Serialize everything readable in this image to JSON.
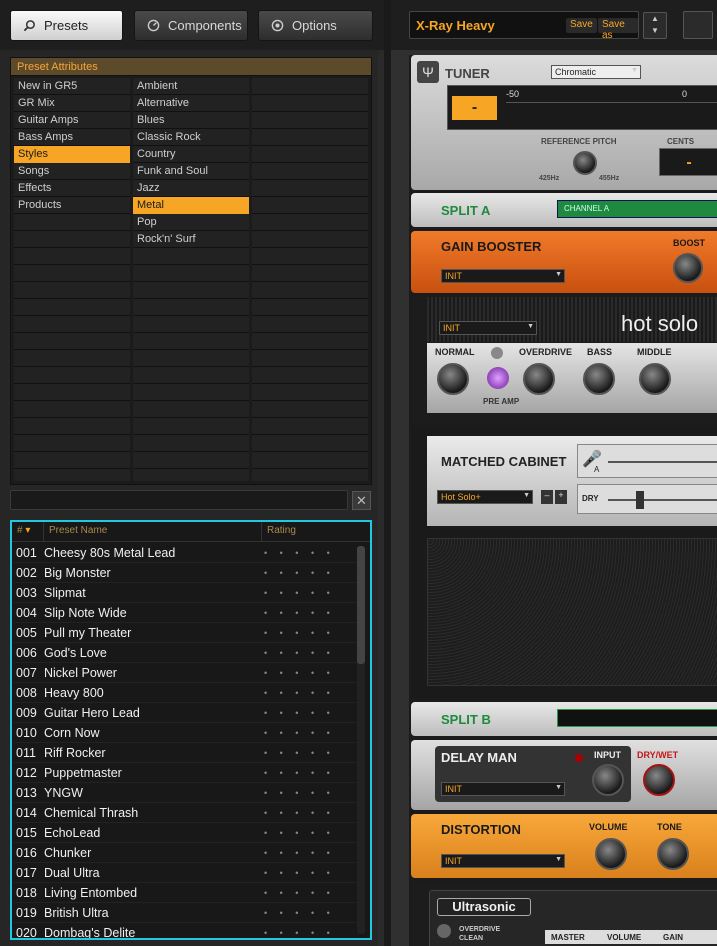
{
  "tabs": [
    {
      "label": "Presets",
      "active": true,
      "icon": "magnifier-icon"
    },
    {
      "label": "Components",
      "active": false,
      "icon": "gauge-icon"
    },
    {
      "label": "Options",
      "active": false,
      "icon": "gear-icon"
    }
  ],
  "attributes": {
    "header": "Preset Attributes",
    "categories": [
      "New in GR5",
      "GR Mix",
      "Guitar Amps",
      "Bass Amps",
      "Styles",
      "Songs",
      "Effects",
      "Products"
    ],
    "selected_category": "Styles",
    "styles": [
      "Ambient",
      "Alternative",
      "Blues",
      "Classic Rock",
      "Country",
      "Funk and Soul",
      "Jazz",
      "Metal",
      "Pop",
      "Rock'n' Surf"
    ],
    "selected_style": "Metal"
  },
  "search": {
    "value": "",
    "clear_icon": "close-icon"
  },
  "results": {
    "headers": {
      "number": "#",
      "name": "Preset Name",
      "rating": "Rating"
    },
    "rows": [
      {
        "no": "001",
        "name": "Cheesy 80s Metal Lead"
      },
      {
        "no": "002",
        "name": "Big Monster"
      },
      {
        "no": "003",
        "name": "Slipmat"
      },
      {
        "no": "004",
        "name": "Slip Note Wide"
      },
      {
        "no": "005",
        "name": "Pull my Theater"
      },
      {
        "no": "006",
        "name": "God's Love"
      },
      {
        "no": "007",
        "name": "Nickel Power"
      },
      {
        "no": "008",
        "name": "Heavy 800"
      },
      {
        "no": "009",
        "name": "Guitar Hero Lead"
      },
      {
        "no": "010",
        "name": "Corn Now"
      },
      {
        "no": "011",
        "name": "Riff Rocker"
      },
      {
        "no": "012",
        "name": "Puppetmaster"
      },
      {
        "no": "013",
        "name": "YNGW"
      },
      {
        "no": "014",
        "name": "Chemical Thrash"
      },
      {
        "no": "015",
        "name": "EchoLead"
      },
      {
        "no": "016",
        "name": "Chunker"
      },
      {
        "no": "017",
        "name": "Dual Ultra"
      },
      {
        "no": "018",
        "name": "Living Entombed"
      },
      {
        "no": "019",
        "name": "British Ultra"
      },
      {
        "no": "020",
        "name": "Dombag's Delite"
      }
    ],
    "rating_dots": "• • • • •"
  },
  "preset_bar": {
    "name": "X-Ray Heavy",
    "save": "Save",
    "save_as": "Save as"
  },
  "tuner": {
    "title": "TUNER",
    "mode": "Chromatic",
    "scale_left": "-50",
    "scale_mid": "0",
    "display": "-",
    "ref_label": "REFERENCE PITCH",
    "low": "425Hz",
    "high": "455Hz",
    "cents": "CENTS",
    "cents_value": "-"
  },
  "split_a": {
    "title": "SPLIT A",
    "channel": "CHANNEL A"
  },
  "gain_booster": {
    "title": "GAIN BOOSTER",
    "preset": "INIT",
    "knob": "BOOST"
  },
  "amp": {
    "preset": "INIT",
    "brand": "hot solo",
    "normal": "NORMAL",
    "overdrive": "OVERDRIVE",
    "bass": "BASS",
    "middle": "MIDDLE",
    "preamp": "PRE AMP"
  },
  "cabinet": {
    "title": "MATCHED CABINET",
    "preset": "Hot Solo+",
    "mic": "A",
    "dry": "DRY",
    "minus": "–",
    "plus": "+"
  },
  "split_b": {
    "title": "SPLIT B"
  },
  "delay": {
    "title": "DELAY MAN",
    "preset": "INIT",
    "input": "INPUT",
    "drywet": "DRY/WET"
  },
  "distortion": {
    "title": "DISTORTION",
    "preset": "INIT",
    "volume": "VOLUME",
    "tone": "TONE"
  },
  "ultrasonic": {
    "title": "Ultrasonic",
    "overdrive": "OVERDRIVE",
    "clean": "CLEAN",
    "master": "MASTER",
    "volume": "VOLUME",
    "gain": "GAIN"
  },
  "colors": {
    "accent": "#f6a624",
    "selection_border": "#22c7e0",
    "green": "#2a9a4a",
    "orange": "#e8641a"
  }
}
